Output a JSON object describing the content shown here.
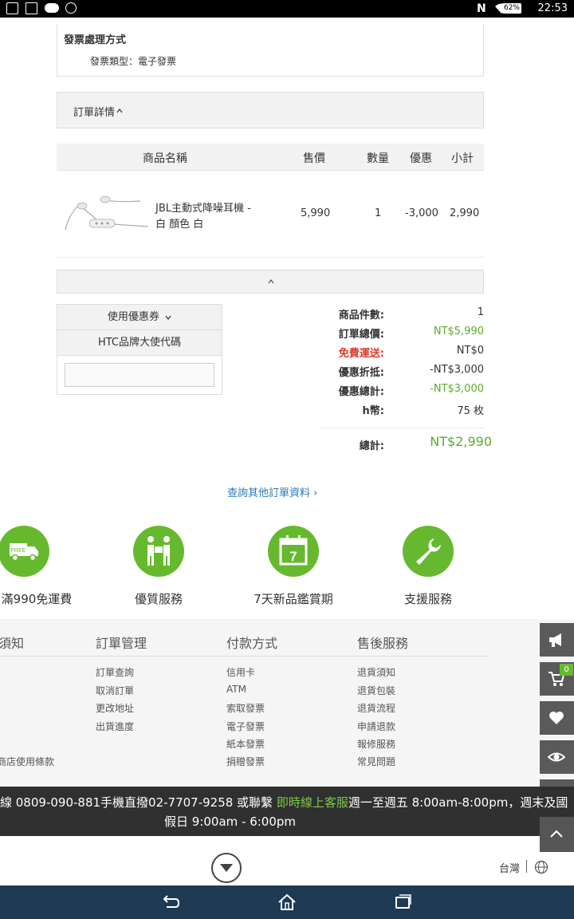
{
  "status_bar": {
    "time": "22:53",
    "battery": "62%"
  },
  "invoice": {
    "title": "發票處理方式",
    "type_line": "發票類型：電子發票"
  },
  "order_details": {
    "label": "訂單詳情"
  },
  "table": {
    "headers": [
      "商品名稱",
      "售價",
      "數量",
      "優惠",
      "小計"
    ],
    "row": {
      "name_line1": "JBL主動式降噪耳機 -",
      "name_line2": "白 顏色 白",
      "price": "5,990",
      "qty": "1",
      "discount": "-3,000",
      "subtotal": "2,990"
    }
  },
  "coupon": {
    "toggle_label": "使用優惠券",
    "brand_code_label": "HTC品牌大使代碼",
    "input_value": ""
  },
  "summary": {
    "count_label": "商品件數:",
    "count_value": "1",
    "total_label": "訂單總價:",
    "total_value": "NT$5,990",
    "shipping_label": "免費運送:",
    "shipping_value": "NT$0",
    "discount_label": "優惠折抵:",
    "discount_value": "-NT$3,000",
    "discount_total_label": "優惠總計:",
    "discount_total_value": "-NT$3,000",
    "coin_label": "h幣:",
    "coin_value": "75 枚",
    "grand_label": "總計:",
    "grand_value": "NT$2,990"
  },
  "more_orders_link": "查詢其他訂單資料 ›",
  "features": [
    {
      "label": "滿990免運費",
      "icon_text": "FREE"
    },
    {
      "label": "優質服務"
    },
    {
      "label": "7天新品鑑賞期",
      "icon_text": "7"
    },
    {
      "label": "支援服務"
    }
  ],
  "footer": {
    "col1": {
      "title": "須知",
      "items": [
        "",
        "",
        "",
        "",
        "",
        "商店使用條款"
      ]
    },
    "col2": {
      "title": "訂單管理",
      "items": [
        "訂單查詢",
        "取消訂單",
        "更改地址",
        "出貨進度"
      ]
    },
    "col3": {
      "title": "付款方式",
      "items": [
        "信用卡",
        "ATM",
        "索取發票",
        "電子發票",
        "紙本發票",
        "捐贈發票"
      ]
    },
    "col4": {
      "title": "售後服務",
      "items": [
        "退貨須知",
        "退貨包裝",
        "退貨流程",
        "申請退款",
        "報修服務",
        "常見問題"
      ]
    }
  },
  "side": {
    "cart_count": "0"
  },
  "marquee": {
    "line1_a": "線 0809-090-881手機直撥02-7707-9258 或聯繫 ",
    "line1_link": "即時線上客服",
    "line1_b": "週一至週五 8:00am-8:00pm，週末及國",
    "line2": "假日 9:00am - 6:00pm"
  },
  "region": {
    "label": "台灣"
  }
}
